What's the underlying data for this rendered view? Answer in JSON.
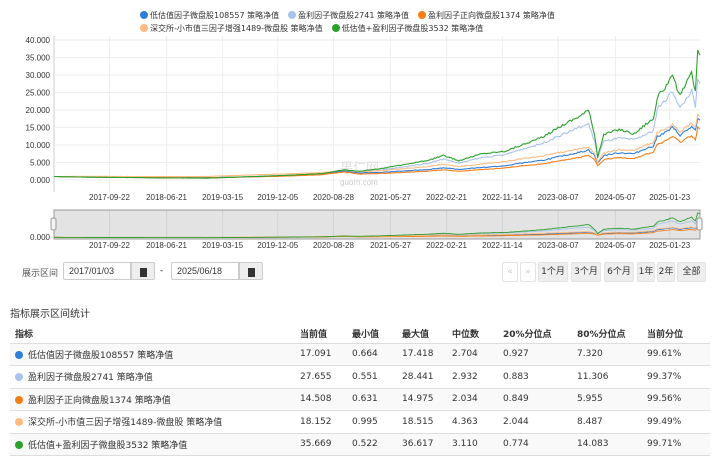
{
  "legend": [
    {
      "name": "低估值因子微盘股108557 策略净值",
      "color": "#2f7ed8"
    },
    {
      "name": "盈利因子微盘股2741 策略净值",
      "color": "#a9c4ec"
    },
    {
      "name": "盈利因子正向微盘股1374 策略净值",
      "color": "#f57f17"
    },
    {
      "name": "深交所-小市值三因子增强1489-微盘股 策略净值",
      "color": "#fdbb80"
    },
    {
      "name": "低估值+盈利因子微盘股3532 策略净值",
      "color": "#2ca02c"
    }
  ],
  "watermark": {
    "name": "果仁网",
    "url": "guorn.com"
  },
  "chart_data": {
    "type": "line",
    "ylim": [
      0,
      40
    ],
    "yticks": [
      "0.000",
      "5.000",
      "10.000",
      "15.000",
      "20.000",
      "25.000",
      "30.000",
      "35.000",
      "40.000"
    ],
    "xrange": [
      "2017/01/03",
      "2025/06/18"
    ],
    "xticks": [
      "2017-09-22",
      "2018-06-21",
      "2019-03-15",
      "2019-12-05",
      "2020-08-28",
      "2021-05-27",
      "2022-02-21",
      "2022-11-14",
      "2023-08-07",
      "2024-05-07",
      "2025-01-23"
    ],
    "navigator_ytick": "0.000",
    "x_note": "x in fractional years",
    "series": [
      {
        "name": "低估值因子微盘股108557 策略净值",
        "color": "#2f7ed8",
        "points": [
          [
            2017.0,
            1.0
          ],
          [
            2017.5,
            0.85
          ],
          [
            2018.0,
            0.75
          ],
          [
            2018.5,
            0.68
          ],
          [
            2019.0,
            0.66
          ],
          [
            2019.5,
            0.9
          ],
          [
            2020.0,
            1.2
          ],
          [
            2020.5,
            1.6
          ],
          [
            2020.8,
            2.6
          ],
          [
            2021.0,
            2.0
          ],
          [
            2021.3,
            2.2
          ],
          [
            2021.6,
            2.6
          ],
          [
            2021.9,
            3.0
          ],
          [
            2022.1,
            3.5
          ],
          [
            2022.3,
            3.0
          ],
          [
            2022.6,
            3.6
          ],
          [
            2022.9,
            4.0
          ],
          [
            2023.1,
            4.8
          ],
          [
            2023.4,
            5.6
          ],
          [
            2023.6,
            6.6
          ],
          [
            2023.9,
            8.0
          ],
          [
            2024.0,
            8.6
          ],
          [
            2024.08,
            7.0
          ],
          [
            2024.12,
            4.8
          ],
          [
            2024.2,
            7.0
          ],
          [
            2024.4,
            7.8
          ],
          [
            2024.6,
            7.5
          ],
          [
            2024.75,
            9.0
          ],
          [
            2024.85,
            9.6
          ],
          [
            2024.9,
            12.5
          ],
          [
            2025.0,
            13.5
          ],
          [
            2025.1,
            15.0
          ],
          [
            2025.2,
            12.8
          ],
          [
            2025.35,
            15.2
          ],
          [
            2025.4,
            14.0
          ],
          [
            2025.43,
            17.4
          ],
          [
            2025.46,
            17.091
          ]
        ]
      },
      {
        "name": "盈利因子微盘股2741 策略净值",
        "color": "#a9c4ec",
        "points": [
          [
            2017.0,
            1.0
          ],
          [
            2017.5,
            0.8
          ],
          [
            2018.0,
            0.7
          ],
          [
            2018.5,
            0.6
          ],
          [
            2019.0,
            0.55
          ],
          [
            2019.5,
            0.9
          ],
          [
            2020.0,
            1.3
          ],
          [
            2020.5,
            1.8
          ],
          [
            2020.8,
            2.9
          ],
          [
            2021.0,
            2.3
          ],
          [
            2021.3,
            2.9
          ],
          [
            2021.6,
            3.8
          ],
          [
            2021.9,
            4.8
          ],
          [
            2022.1,
            6.0
          ],
          [
            2022.3,
            4.8
          ],
          [
            2022.6,
            6.4
          ],
          [
            2022.9,
            7.2
          ],
          [
            2023.1,
            8.6
          ],
          [
            2023.4,
            10.5
          ],
          [
            2023.6,
            12.5
          ],
          [
            2023.9,
            15.2
          ],
          [
            2024.0,
            16.0
          ],
          [
            2024.08,
            11.0
          ],
          [
            2024.12,
            6.5
          ],
          [
            2024.2,
            11.0
          ],
          [
            2024.4,
            12.0
          ],
          [
            2024.6,
            11.5
          ],
          [
            2024.75,
            13.0
          ],
          [
            2024.85,
            14.0
          ],
          [
            2024.9,
            20.5
          ],
          [
            2025.0,
            22.5
          ],
          [
            2025.1,
            25.5
          ],
          [
            2025.2,
            20.5
          ],
          [
            2025.35,
            25.5
          ],
          [
            2025.4,
            21.0
          ],
          [
            2025.43,
            28.4
          ],
          [
            2025.46,
            27.655
          ]
        ]
      },
      {
        "name": "盈利因子正向微盘股1374 策略净值",
        "color": "#f57f17",
        "points": [
          [
            2017.0,
            1.0
          ],
          [
            2017.5,
            0.85
          ],
          [
            2018.0,
            0.75
          ],
          [
            2018.5,
            0.66
          ],
          [
            2019.0,
            0.63
          ],
          [
            2019.5,
            0.85
          ],
          [
            2020.0,
            1.1
          ],
          [
            2020.5,
            1.5
          ],
          [
            2020.8,
            2.3
          ],
          [
            2021.0,
            1.7
          ],
          [
            2021.3,
            1.9
          ],
          [
            2021.6,
            2.2
          ],
          [
            2021.9,
            2.5
          ],
          [
            2022.1,
            2.9
          ],
          [
            2022.3,
            2.5
          ],
          [
            2022.6,
            3.0
          ],
          [
            2022.9,
            3.4
          ],
          [
            2023.1,
            4.0
          ],
          [
            2023.4,
            4.6
          ],
          [
            2023.6,
            5.5
          ],
          [
            2023.9,
            6.5
          ],
          [
            2024.0,
            7.0
          ],
          [
            2024.08,
            5.8
          ],
          [
            2024.12,
            4.0
          ],
          [
            2024.2,
            5.8
          ],
          [
            2024.4,
            6.4
          ],
          [
            2024.6,
            6.2
          ],
          [
            2024.75,
            7.3
          ],
          [
            2024.85,
            8.0
          ],
          [
            2024.9,
            10.2
          ],
          [
            2025.0,
            11.0
          ],
          [
            2025.1,
            12.5
          ],
          [
            2025.2,
            10.8
          ],
          [
            2025.35,
            12.8
          ],
          [
            2025.4,
            11.5
          ],
          [
            2025.43,
            15.0
          ],
          [
            2025.46,
            14.508
          ]
        ]
      },
      {
        "name": "深交所-小市值三因子增强1489-微盘股 策略净值",
        "color": "#fdbb80",
        "points": [
          [
            2017.0,
            1.0
          ],
          [
            2017.5,
            1.05
          ],
          [
            2018.0,
            1.0
          ],
          [
            2018.5,
            1.0
          ],
          [
            2019.0,
            1.0
          ],
          [
            2019.5,
            1.4
          ],
          [
            2020.0,
            1.7
          ],
          [
            2020.5,
            2.1
          ],
          [
            2020.8,
            2.8
          ],
          [
            2021.0,
            2.4
          ],
          [
            2021.3,
            2.7
          ],
          [
            2021.6,
            3.3
          ],
          [
            2021.9,
            3.8
          ],
          [
            2022.1,
            4.5
          ],
          [
            2022.3,
            3.8
          ],
          [
            2022.6,
            4.6
          ],
          [
            2022.9,
            5.2
          ],
          [
            2023.1,
            6.0
          ],
          [
            2023.4,
            6.8
          ],
          [
            2023.6,
            7.8
          ],
          [
            2023.9,
            9.0
          ],
          [
            2024.0,
            9.3
          ],
          [
            2024.08,
            7.5
          ],
          [
            2024.12,
            5.0
          ],
          [
            2024.2,
            7.8
          ],
          [
            2024.4,
            8.6
          ],
          [
            2024.6,
            8.4
          ],
          [
            2024.75,
            10.0
          ],
          [
            2024.85,
            10.6
          ],
          [
            2024.9,
            13.5
          ],
          [
            2025.0,
            14.5
          ],
          [
            2025.1,
            16.0
          ],
          [
            2025.2,
            13.8
          ],
          [
            2025.35,
            16.2
          ],
          [
            2025.4,
            15.0
          ],
          [
            2025.43,
            18.5
          ],
          [
            2025.46,
            18.152
          ]
        ]
      },
      {
        "name": "低估值+盈利因子微盘股3532 策略净值",
        "color": "#2ca02c",
        "points": [
          [
            2017.0,
            1.0
          ],
          [
            2017.5,
            0.8
          ],
          [
            2018.0,
            0.7
          ],
          [
            2018.5,
            0.58
          ],
          [
            2019.0,
            0.52
          ],
          [
            2019.5,
            0.9
          ],
          [
            2020.0,
            1.3
          ],
          [
            2020.5,
            1.8
          ],
          [
            2020.8,
            2.9
          ],
          [
            2021.0,
            2.5
          ],
          [
            2021.3,
            3.3
          ],
          [
            2021.6,
            4.5
          ],
          [
            2021.9,
            5.6
          ],
          [
            2022.1,
            7.0
          ],
          [
            2022.3,
            5.5
          ],
          [
            2022.6,
            7.5
          ],
          [
            2022.9,
            8.2
          ],
          [
            2023.1,
            9.8
          ],
          [
            2023.4,
            12.2
          ],
          [
            2023.6,
            15.0
          ],
          [
            2023.9,
            18.5
          ],
          [
            2024.0,
            20.0
          ],
          [
            2024.08,
            13.0
          ],
          [
            2024.12,
            6.5
          ],
          [
            2024.2,
            13.0
          ],
          [
            2024.4,
            14.5
          ],
          [
            2024.6,
            13.2
          ],
          [
            2024.75,
            16.0
          ],
          [
            2024.85,
            17.5
          ],
          [
            2024.9,
            23.5
          ],
          [
            2025.0,
            26.5
          ],
          [
            2025.1,
            29.5
          ],
          [
            2025.2,
            24.0
          ],
          [
            2025.35,
            30.5
          ],
          [
            2025.4,
            25.0
          ],
          [
            2025.43,
            36.6
          ],
          [
            2025.46,
            35.669
          ]
        ]
      }
    ]
  },
  "controls": {
    "range_label": "展示区间",
    "start_date": "2017/01/03",
    "separator": "-",
    "end_date": "2025/06/18",
    "prev": "«",
    "next": "»",
    "ranges": [
      "1个月",
      "3个月",
      "6个月",
      "1年",
      "2年",
      "全部"
    ]
  },
  "stats": {
    "title": "指标展示区间统计",
    "headers": [
      "指标",
      "当前值",
      "最小值",
      "最大值",
      "中位数",
      "20%分位点",
      "80%分位点",
      "当前分位"
    ],
    "rows": [
      {
        "color": "#2f7ed8",
        "cells": [
          "低估值因子微盘股108557 策略净值",
          "17.091",
          "0.664",
          "17.418",
          "2.704",
          "0.927",
          "7.320",
          "99.61%"
        ]
      },
      {
        "color": "#a9c4ec",
        "cells": [
          "盈利因子微盘股2741 策略净值",
          "27.655",
          "0.551",
          "28.441",
          "2.932",
          "0.883",
          "11.306",
          "99.37%"
        ]
      },
      {
        "color": "#f57f17",
        "cells": [
          "盈利因子正向微盘股1374 策略净值",
          "14.508",
          "0.631",
          "14.975",
          "2.034",
          "0.849",
          "5.955",
          "99.56%"
        ]
      },
      {
        "color": "#fdbb80",
        "cells": [
          "深交所-小市值三因子增强1489-微盘股 策略净值",
          "18.152",
          "0.995",
          "18.515",
          "4.363",
          "2.044",
          "8.487",
          "99.49%"
        ]
      },
      {
        "color": "#2ca02c",
        "cells": [
          "低估值+盈利因子微盘股3532 策略净值",
          "35.669",
          "0.522",
          "36.617",
          "3.110",
          "0.774",
          "14.083",
          "99.71%"
        ]
      }
    ]
  }
}
